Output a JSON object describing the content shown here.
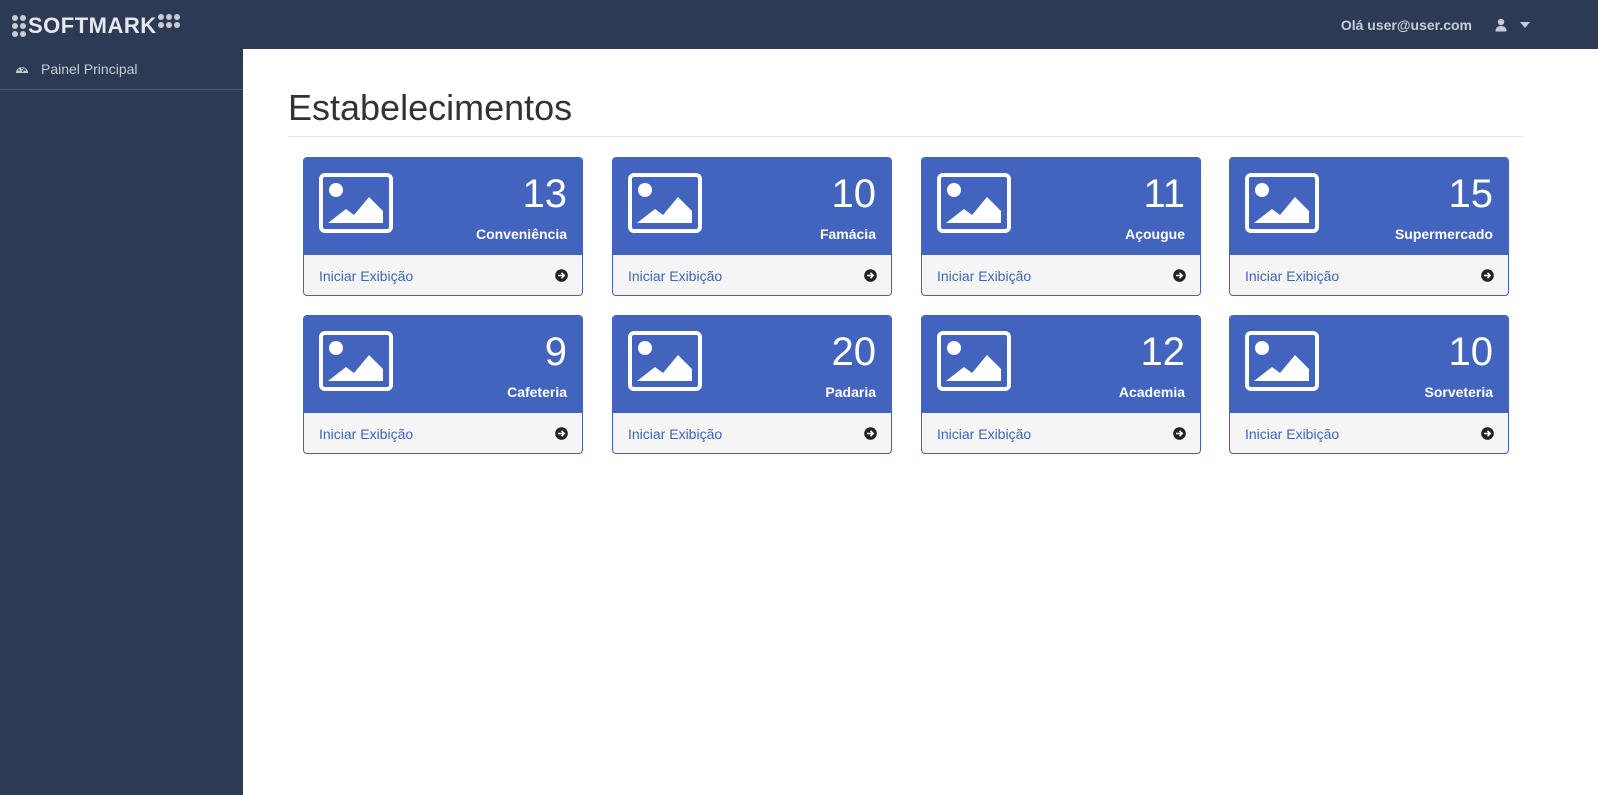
{
  "header": {
    "logo_text": "SOFTMARK",
    "greeting": "Olá user@user.com",
    "user_icon": "user-icon",
    "menu_icon": "caret-down-icon"
  },
  "sidebar": {
    "items": [
      {
        "label": "Painel Principal",
        "icon": "dashboard-icon"
      }
    ]
  },
  "main": {
    "title": "Estabelecimentos",
    "link_label": "Iniciar Exibição",
    "cards": [
      {
        "count": "13",
        "name": "Conveniência"
      },
      {
        "count": "10",
        "name": "Famácia"
      },
      {
        "count": "11",
        "name": "Açougue"
      },
      {
        "count": "15",
        "name": "Supermercado"
      },
      {
        "count": "9",
        "name": "Cafeteria"
      },
      {
        "count": "20",
        "name": "Padaria"
      },
      {
        "count": "12",
        "name": "Academia"
      },
      {
        "count": "10",
        "name": "Sorveteria"
      }
    ]
  },
  "colors": {
    "nav_bg": "#2c3a55",
    "card_accent": "#4264bf",
    "link": "#3c66b8"
  }
}
